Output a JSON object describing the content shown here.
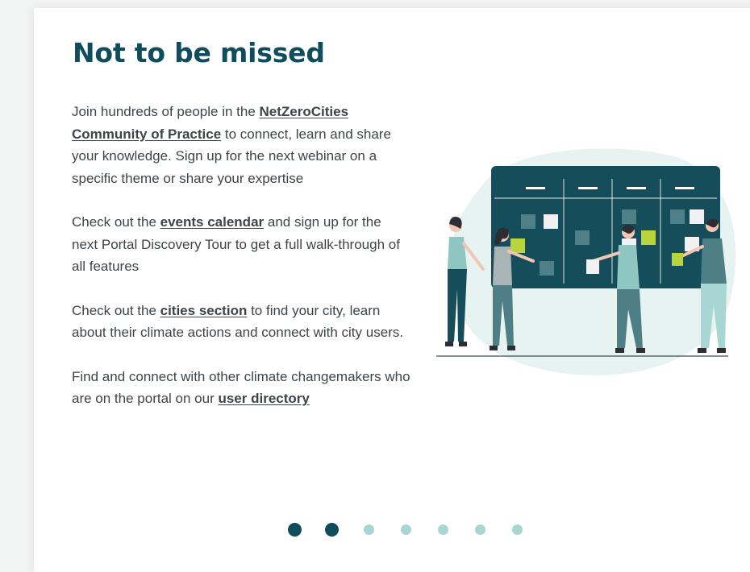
{
  "title": "Not to be missed",
  "paragraphs": [
    {
      "before": "Join hundreds of people in the ",
      "link": "NetZeroCities Community of Practice",
      "after": " to connect, learn and share your knowledge. Sign up for the next webinar on a specific theme or share your expertise"
    },
    {
      "before": "Check out the ",
      "link": "events calendar",
      "after": " and sign up for the next Portal Discovery Tour to get a full walk-through of all features"
    },
    {
      "before": "Check out the ",
      "link": "cities section",
      "after": " to find your city, learn about their climate actions and connect with city users."
    },
    {
      "before": "Find and connect with other climate changemakers who are on the portal on our ",
      "link": "user directory",
      "after": ""
    }
  ],
  "carousel": {
    "total": 7,
    "active": [
      0,
      1
    ]
  },
  "colors": {
    "title": "#0f4c5c",
    "board": "#164d5b",
    "accent_green": "#b9d53c",
    "dot_active": "#0f4c5c",
    "dot_inactive": "#a8d6d2"
  },
  "illustration": {
    "icon": "team-planning-board-illustration"
  }
}
